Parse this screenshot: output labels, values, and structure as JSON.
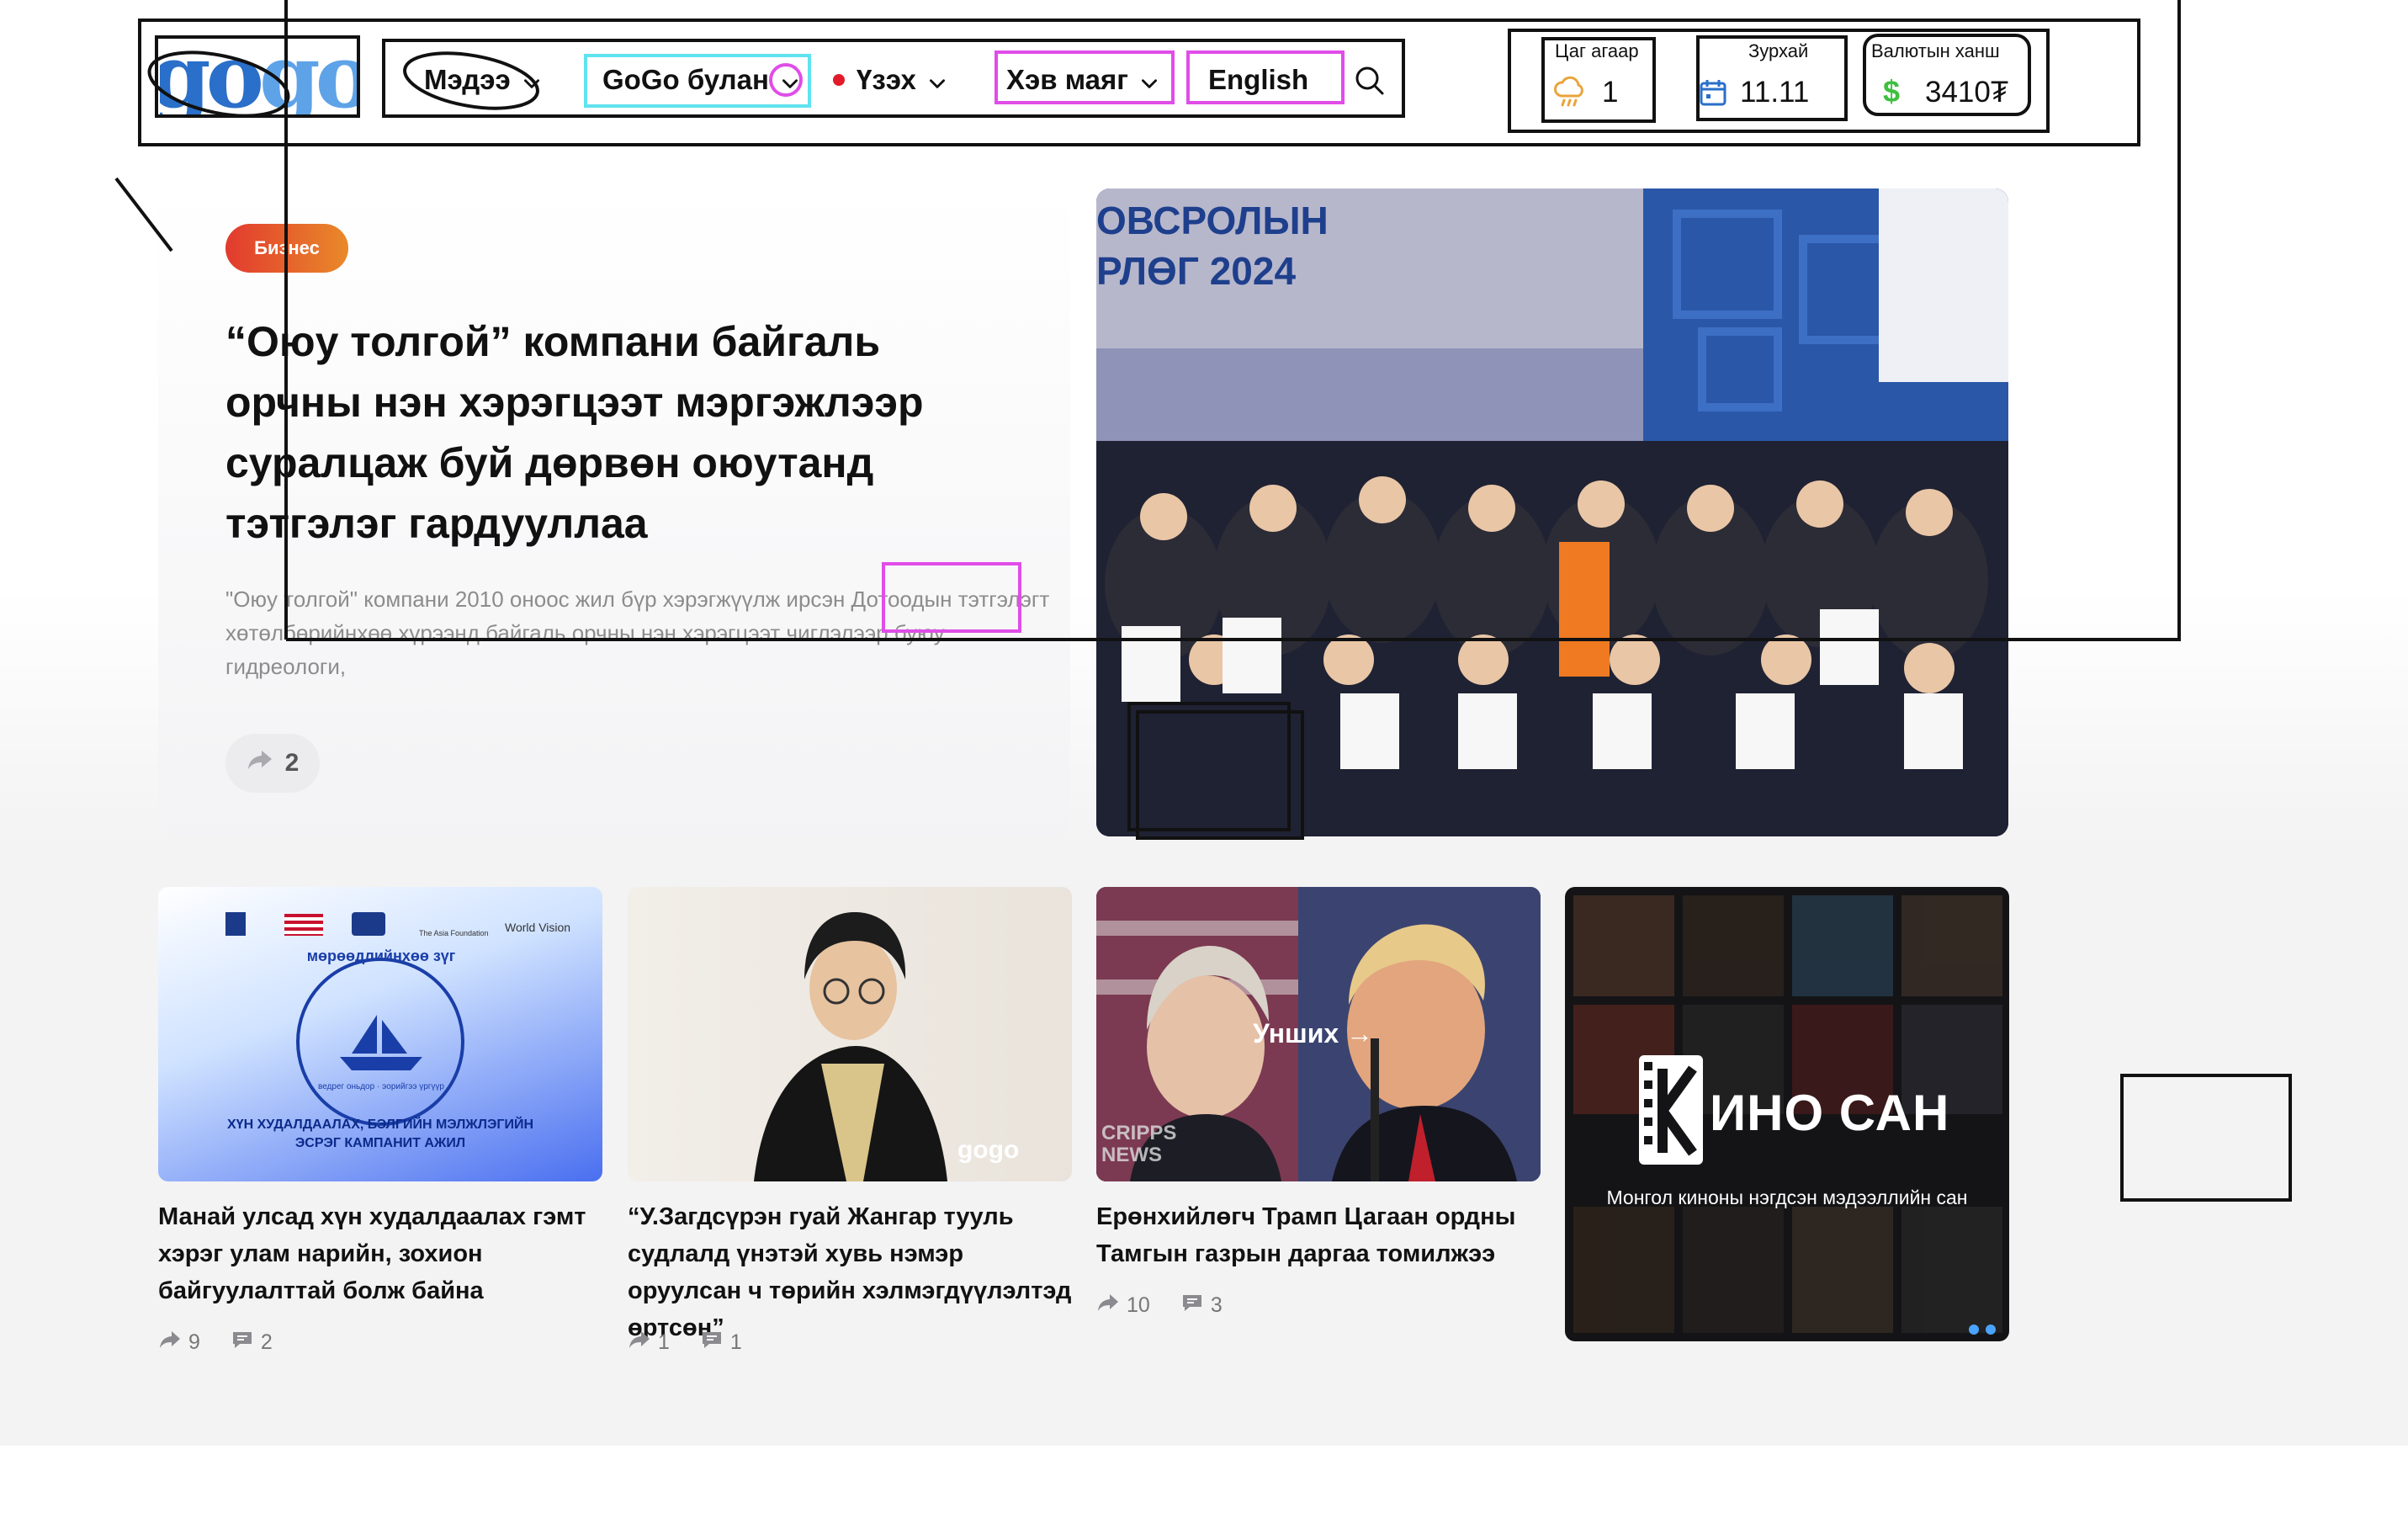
{
  "header": {
    "logo_text_a": "go",
    "logo_text_b": "go",
    "nav": [
      {
        "label": "Мэдээ"
      },
      {
        "label": "GoGo булан"
      },
      {
        "label": "Үзэх"
      },
      {
        "label": "Хэв маяг"
      },
      {
        "label": "English"
      }
    ],
    "weather": {
      "label": "Цаг агаар",
      "value": "1"
    },
    "horoscope": {
      "label": "Зурхай",
      "value": "11.11"
    },
    "currency": {
      "label": "Валютын ханш",
      "symbol": "$",
      "value": "3410₮"
    }
  },
  "hero": {
    "category": "Бизнес",
    "title": "“Оюу толгой” компани байгаль орчны нэн хэрэгцээт мэргэжлээр суралцаж буй дөрвөн оюутанд тэтгэлэг гардууллаа",
    "excerpt": "\"Оюу толгой\" компани 2010 оноос жил бүр хэрэгжүүлж ирсэн Дотоодын тэтгэлэгт хөтөлбөрийнхөө хүрээнд байгаль орчны нэн хэрэгцээт чиглэлээр буюу гидреологи,",
    "shares": "2",
    "photo_banner_line1": "ОВСРОЛЫН",
    "photo_banner_line2": "РЛӨГ 2024"
  },
  "cards": [
    {
      "title": "Манай улсад хүн худалдаалах гэмт хэрэг улам нарийн, зохион байгуулалттай болж байна",
      "shares": "9",
      "comments": "2",
      "img_caption": "ХҮН ХУДАЛДААЛАХ, БЭЛГИЙН МЭЛЖЛЭГИЙН ЭСРЭГ КАМПАНИТ АЖИЛ",
      "img_arc": "мөрөөдлийнхөө зүг",
      "img_sub": "ведрег оньдор · эорийгээ үргүүр",
      "img_partner1": "The Asia Foundation",
      "img_partner2": "World Vision"
    },
    {
      "title": "“У.Загдсүрэн гуай Жангар тууль судлалд үнэтэй хувь нэмэр оруулсан ч төрийн хэлмэгдүүлэлтэд өртсөн”",
      "shares": "1",
      "comments": "1",
      "img_watermark": "gogo"
    },
    {
      "title": "Ерөнхийлөгч Трамп Цагаан ордны Тамгын газрын даргаа томилжээ",
      "shares": "10",
      "comments": "3",
      "img_overlay": "Унших →",
      "img_watermark": "CRIPPS NEWS"
    }
  ],
  "kino": {
    "title": "ИНО САН",
    "subtitle": "Монгол киноны нэгдсэн мэдээллийн сан"
  },
  "colors": {
    "accent_blue": "#2a6fc9",
    "badge_start": "#e23a2e",
    "badge_end": "#e98a2a",
    "annotation_magenta": "#e04de8",
    "annotation_cyan": "#5fe3ef",
    "currency_green": "#3fbf3f"
  }
}
